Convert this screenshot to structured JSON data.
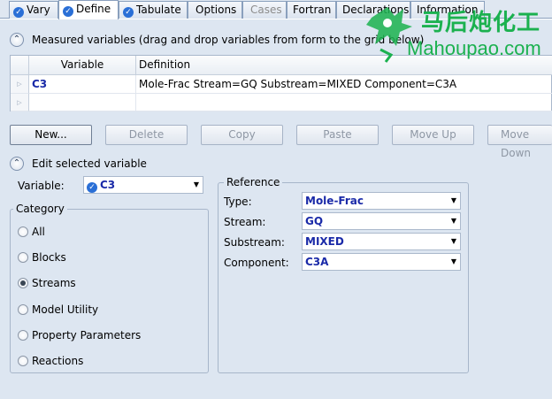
{
  "tabs": [
    {
      "label": "Vary",
      "checked": true,
      "state": "normal"
    },
    {
      "label": "Define",
      "checked": true,
      "state": "active"
    },
    {
      "label": "Tabulate",
      "checked": true,
      "state": "normal"
    },
    {
      "label": "Options",
      "checked": false,
      "state": "normal"
    },
    {
      "label": "Cases",
      "checked": false,
      "state": "disabled"
    },
    {
      "label": "Fortran",
      "checked": false,
      "state": "normal"
    },
    {
      "label": "Declarations",
      "checked": false,
      "state": "normal"
    },
    {
      "label": "Information",
      "checked": false,
      "state": "normal"
    }
  ],
  "measured": {
    "title": "Measured variables (drag and drop variables from form to the grid below)",
    "collapse_glyph": "⌃",
    "columns": [
      "Variable",
      "Definition"
    ],
    "rows": [
      {
        "variable": "C3",
        "definition": "Mole-Frac Stream=GQ Substream=MIXED Component=C3A"
      },
      {
        "variable": "",
        "definition": ""
      }
    ],
    "row_marker": "▷"
  },
  "buttons": {
    "new": "New...",
    "delete": "Delete",
    "copy": "Copy",
    "paste": "Paste",
    "move_up": "Move Up",
    "move_down": "Move Down"
  },
  "edit": {
    "title": "Edit selected variable",
    "variable_label": "Variable:",
    "variable_value": "C3",
    "dropdown_arrow": "▼"
  },
  "category": {
    "title": "Category",
    "options": [
      "All",
      "Blocks",
      "Streams",
      "Model Utility",
      "Property Parameters",
      "Reactions"
    ],
    "selected": "Streams"
  },
  "reference": {
    "title": "Reference",
    "fields": [
      {
        "label": "Type:",
        "value": "Mole-Frac"
      },
      {
        "label": "Stream:",
        "value": "GQ"
      },
      {
        "label": "Substream:",
        "value": "MIXED"
      },
      {
        "label": "Component:",
        "value": "C3A"
      }
    ]
  },
  "watermark": {
    "chinese": "马后炮化工",
    "english": "Mahoupao.com"
  },
  "colors": {
    "accent_blue": "#1a2aa8",
    "watermark_green": "#1bb14f",
    "panel_bg": "#dde6f1"
  }
}
